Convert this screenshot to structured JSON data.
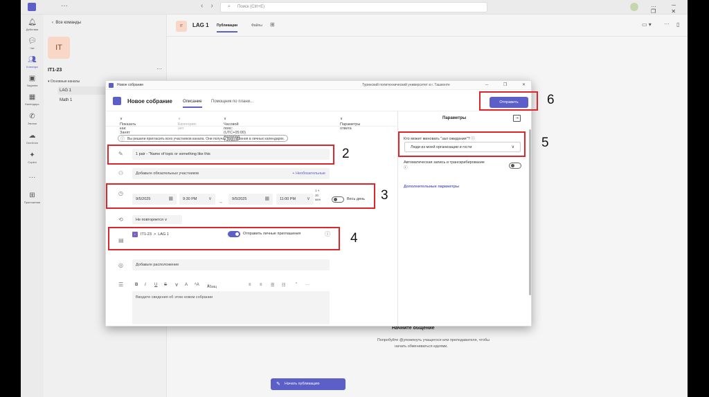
{
  "topbar": {
    "search_placeholder": "Поиск (Ctrl+E)",
    "nav_back": "‹",
    "nav_forward": "›",
    "menu_dots": "···",
    "window_controls": "… ─ ❐ ✕"
  },
  "rail": {
    "items": [
      {
        "label": "Действия",
        "icon": "bell-icon"
      },
      {
        "label": "Чат",
        "icon": "chat-icon"
      },
      {
        "label": "Команды",
        "icon": "teams-icon"
      },
      {
        "label": "Задания",
        "icon": "assignments-icon"
      },
      {
        "label": "Календарь",
        "icon": "calendar-icon"
      },
      {
        "label": "Звонки",
        "icon": "phone-icon"
      },
      {
        "label": "OneDrive",
        "icon": "cloud-icon"
      },
      {
        "label": "Copilot",
        "icon": "copilot-icon"
      },
      {
        "label": "···",
        "icon": "more-icon"
      },
      {
        "label": "Приложения",
        "icon": "apps-icon"
      }
    ]
  },
  "sidebar": {
    "back_label": "Все команды",
    "team_initials": "IT",
    "team_name": "IT1-23",
    "more": "···",
    "section": "Основные каналы",
    "channels": [
      "LAG 1",
      "Math 1"
    ]
  },
  "header": {
    "tile": "IT",
    "title": "LAG 1",
    "tabs": [
      "Публикации",
      "Файлы"
    ]
  },
  "empty_state": {
    "title": "Начните общение",
    "line1": "Попробуйте @упомянуть учащегося или преподавателя, чтобы",
    "line2": "начать обмениваться идеями.",
    "start_post": "Начать публикацию"
  },
  "dialog": {
    "window_title": "Новое собрание",
    "org": "Туринский политехнический университет в г. Ташкенте",
    "window_controls": "─ ❐ ✕",
    "title": "Новое собрание",
    "tabs": [
      "Описание",
      "Помощник по плани..."
    ],
    "send": "Отправить",
    "options_bar": {
      "show_as": "Показать как: Занят",
      "category": "Категория: нет",
      "timezone": "Часовой пояс: (UTC+05:00) Ашхабад, Ташкент",
      "response": "Параметры ответа"
    },
    "info": "Вы решили пригласить всех участников канала. Они получат приглашения в личных календарях.",
    "meeting_title": "1 pair - \"Name of topic or something like this",
    "attendees_placeholder": "Добавьте обязательных участников",
    "optional": "+ Необязательные",
    "start_date": "9/5/2025",
    "start_time": "9:30 PM",
    "end_date": "9/5/2025",
    "end_time": "11:00 PM",
    "duration": "1 ч 30 мин",
    "all_day": "Весь день",
    "repeat": "Не повторяется",
    "channel_team": "IT1-23",
    "channel_name": "LAG 1",
    "send_invites": "Отправить личные приглашения",
    "location": "Добавьте расположение",
    "font_size": "Абзац",
    "details_placeholder": "Вводите сведения об этом новом собрании",
    "params": {
      "title": "Параметры",
      "lobby_label": "Кто может миновать \"зал ожидания\"?",
      "lobby_value": "Люди из моей организации и гости",
      "auto_record": "Автоматическая запись и транскрибирование",
      "more": "Дополнительные параметры"
    }
  },
  "annotations": [
    "2",
    "3",
    "4",
    "5",
    "6"
  ],
  "colors": {
    "accent": "#5b5fc7",
    "annotation": "#e0242a"
  }
}
